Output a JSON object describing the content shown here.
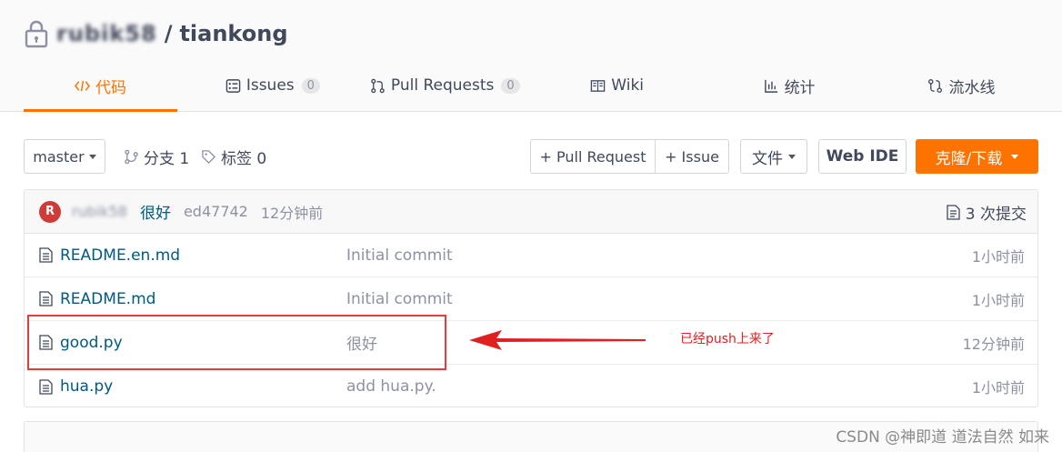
{
  "repo": {
    "owner": "rubik58",
    "separator": "/",
    "name": "tiankong"
  },
  "tabs": [
    {
      "label": "代码",
      "icon": "code-icon",
      "active": true
    },
    {
      "label": "Issues",
      "count": "0",
      "icon": "issues-icon"
    },
    {
      "label": "Pull Requests",
      "count": "0",
      "icon": "pull-request-icon"
    },
    {
      "label": "Wiki",
      "icon": "wiki-book-icon"
    },
    {
      "label": "统计",
      "icon": "bar-chart-icon"
    },
    {
      "label": "流水线",
      "icon": "pipeline-icon"
    }
  ],
  "toolbar": {
    "branch": "master",
    "branches_label": "分支 1",
    "tags_label": "标签 0",
    "pull_request_btn": "+ Pull Request",
    "issue_btn": "+ Issue",
    "file_btn": "文件",
    "webide_btn": "Web IDE",
    "clone_btn": "克隆/下载"
  },
  "last_commit": {
    "avatar_letter": "R",
    "author": "rubik58",
    "message": "很好",
    "sha": "ed47742",
    "time": "12分钟前",
    "commit_count": "3 次提交"
  },
  "files": [
    {
      "name": "README.en.md",
      "commit": "Initial commit",
      "time": "1小时前"
    },
    {
      "name": "README.md",
      "commit": "Initial commit",
      "time": "1小时前"
    },
    {
      "name": "good.py",
      "commit": "很好",
      "time": "12分钟前"
    },
    {
      "name": "hua.py",
      "commit": "add hua.py.",
      "time": "1小时前"
    }
  ],
  "annotation": {
    "text": "已经push上来了",
    "color": "#e02020"
  },
  "watermark": "CSDN @神即道 道法自然 如来",
  "colors": {
    "accent": "#fe7300",
    "link": "#005980",
    "muted": "#8c92a4"
  }
}
